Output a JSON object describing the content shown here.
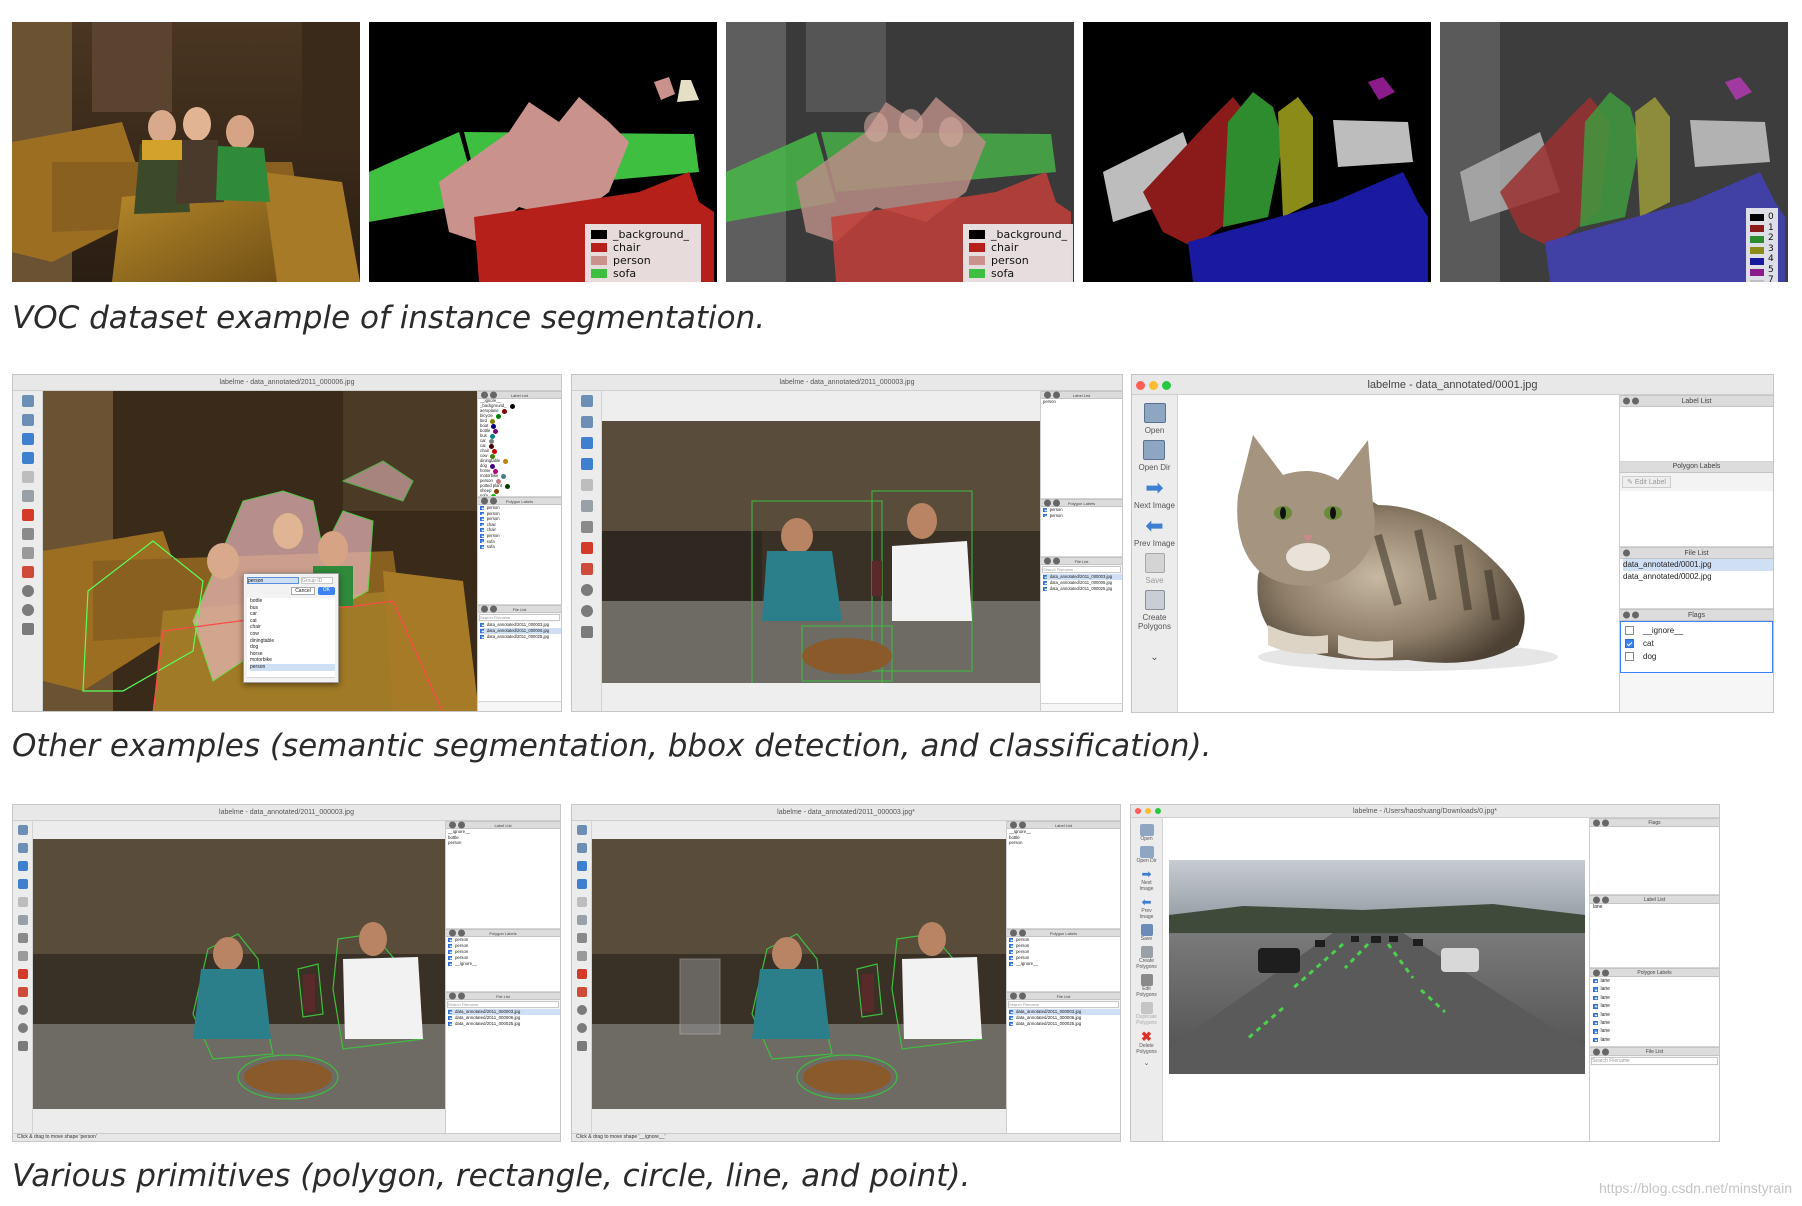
{
  "row1": {
    "legend_a": [
      {
        "label": "_background_",
        "color": "#000000"
      },
      {
        "label": "chair",
        "color": "#b5201a"
      },
      {
        "label": "person",
        "color": "#c9928d"
      },
      {
        "label": "sofa",
        "color": "#3fbf3f"
      }
    ],
    "legend_b": [
      {
        "label": "0",
        "color": "#000000"
      },
      {
        "label": "1",
        "color": "#8b1a1a"
      },
      {
        "label": "2",
        "color": "#2e8b2e"
      },
      {
        "label": "3",
        "color": "#8b8b1a"
      },
      {
        "label": "4",
        "color": "#1a1aa0"
      },
      {
        "label": "5",
        "color": "#8b1a8b"
      },
      {
        "label": "7",
        "color": "#c0c0c0"
      }
    ]
  },
  "captions": {
    "first": "VOC dataset example of instance segmentation.",
    "second": "Other examples (semantic segmentation, bbox detection, and classification).",
    "third": "Various primitives (polygon, rectangle, circle, line, and point)."
  },
  "watermark": "https://blog.csdn.net/minstyrain",
  "win_a": {
    "title": "labelme - data_annotated/2011_000006.jpg",
    "labels": [
      "__ignore__",
      "_background_",
      "aeroplane",
      "bicycle",
      "bird",
      "boat",
      "bottle",
      "bus",
      "car",
      "cat",
      "chair",
      "cow",
      "diningtable",
      "dog",
      "horse",
      "motorbike",
      "person",
      "potted plant",
      "sheep",
      "sofa"
    ],
    "label_dots": [
      "",
      "#000000",
      "#800000",
      "#008000",
      "#808000",
      "#000080",
      "#800080",
      "#008080",
      "#808080",
      "#400000",
      "#c00000",
      "#408000",
      "#c08000",
      "#400080",
      "#c00080",
      "#408080",
      "#c08080",
      "#004000",
      "#804000",
      "#00c000"
    ],
    "polygons": [
      "person",
      "person",
      "person",
      "chair",
      "chair",
      "person",
      "sofa",
      "sofa"
    ],
    "files": [
      "data_annotated/2011_000003.jpg",
      "data_annotated/2011_000006.jpg",
      "data_annotated/2011_000025.jpg"
    ],
    "dialog": {
      "input": "person",
      "group_placeholder": "Group ID",
      "cancel": "Cancel",
      "ok": "OK",
      "items": [
        "bottle",
        "bus",
        "car",
        "cat",
        "chair",
        "cow",
        "diningtable",
        "dog",
        "horse",
        "motorbike",
        "person"
      ]
    }
  },
  "win_b": {
    "title": "labelme - data_annotated/2011_000003.jpg",
    "labels": [
      "person"
    ],
    "polygons": [
      "person",
      "person"
    ],
    "files": [
      "data_annotated/2011_000003.jpg",
      "data_annotated/2011_000006.jpg",
      "data_annotated/2011_000025.jpg"
    ]
  },
  "win_c": {
    "title": "labelme - data_annotated/0001.jpg",
    "toolbar": [
      "Open",
      "Open Dir",
      "Next Image",
      "Prev Image",
      "Save",
      "Create Polygons"
    ],
    "label_list_title": "Label List",
    "polygon_labels_title": "Polygon Labels",
    "edit_label": "Edit Label",
    "file_list_title": "File List",
    "files": [
      "data_annotated/0001.jpg",
      "data_annotated/0002.jpg"
    ],
    "flags_title": "Flags",
    "flags": [
      {
        "label": "__ignore__",
        "checked": false
      },
      {
        "label": "cat",
        "checked": true
      },
      {
        "label": "dog",
        "checked": false
      }
    ]
  },
  "win_d": {
    "title": "labelme - data_annotated/2011_000003.jpg",
    "labels": [
      "__ignore__",
      "bottle",
      "person"
    ],
    "polygons": [
      "person",
      "person",
      "person",
      "person",
      "__ignore__"
    ],
    "search": "Search Filename",
    "files": [
      "data_annotated/2011_000003.jpg",
      "data_annotated/2011_000006.jpg",
      "data_annotated/2011_000025.jpg"
    ],
    "status": "Click & drag to move shape 'person'"
  },
  "win_e": {
    "title": "labelme - data_annotated/2011_000003.jpg*",
    "labels": [
      "__ignore__",
      "bottle",
      "person"
    ],
    "polygons": [
      "person",
      "person",
      "person",
      "person",
      "__ignore__"
    ],
    "search": "Search Filename",
    "files": [
      "data_annotated/2011_000003.jpg",
      "data_annotated/2011_000006.jpg",
      "data_annotated/2011_000025.jpg"
    ],
    "status": "Click & drag to move shape '__ignore__'"
  },
  "win_f": {
    "title": "labelme - /Users/haoshuang/Downloads/0.jpg*",
    "toolbar": [
      "Open",
      "Open Dir",
      "Next Image",
      "Prev Image",
      "Save",
      "Create Polygons",
      "Edit Polygons",
      "Duplicate Polygons",
      "Delete Polygons"
    ],
    "flags_title": "Flags",
    "label_list_title": "Label List",
    "labels": [
      "lane"
    ],
    "polygon_labels_title": "Polygon Labels",
    "polygons": [
      "lane",
      "lane",
      "lane",
      "lane",
      "lane",
      "lane",
      "lane",
      "lane"
    ],
    "file_list_title": "File List",
    "search": "Search Filename"
  },
  "small_dock_titles": {
    "label_list": "Label List",
    "polygon_labels": "Polygon Labels",
    "file_list": "File List"
  },
  "small_search": "Search Filename"
}
